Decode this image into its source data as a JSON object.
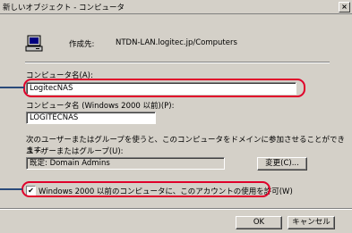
{
  "window": {
    "title": "新しいオブジェクト - コンピュータ",
    "close": "×"
  },
  "header": {
    "create_in_label": "作成先:",
    "create_in_value": "NTDN-LAN.logitec.jp/Computers"
  },
  "computer_name": {
    "label": "コンピュータ名(A):",
    "value": "LogitecNAS"
  },
  "prewin2000_name": {
    "label": "コンピュータ名 (Windows 2000 以前)(P):",
    "value": "LOGITECNAS"
  },
  "join_group": {
    "info": "次のユーザーまたはグループを使うと、このコンピュータをドメインに参加させることができます。",
    "label": "ユーザーまたはグループ(U):",
    "value": "既定: Domain Admins",
    "change_button": "変更(C)..."
  },
  "prewin2000_checkbox": {
    "label": "Windows 2000 以前のコンピュータに、このアカウントの使用を許可(W)",
    "checked": true,
    "mark": "✔"
  },
  "footer": {
    "ok": "OK",
    "cancel": "キャンセル"
  },
  "colors": {
    "highlight_oval": "#e0002a",
    "callout_line": "#2a4a7a"
  }
}
